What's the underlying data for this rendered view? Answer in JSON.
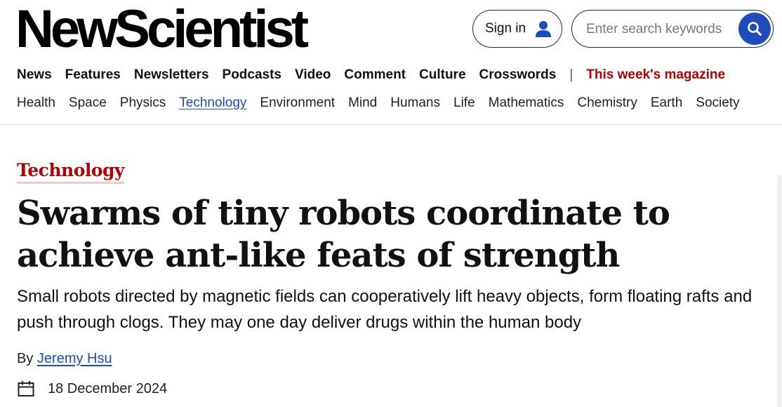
{
  "brand": {
    "logo_text": "NewScientist"
  },
  "account": {
    "signin_label": "Sign in",
    "icon": "user-icon"
  },
  "search": {
    "placeholder": "Enter search keywords",
    "icon": "search-icon",
    "button_color": "#1f4bbc"
  },
  "main_nav": {
    "items": [
      "News",
      "Features",
      "Newsletters",
      "Podcasts",
      "Video",
      "Comment",
      "Culture",
      "Crosswords"
    ],
    "separator": "|",
    "magazine_label": "This week's magazine",
    "magazine_color": "#b30000"
  },
  "sub_nav": {
    "items": [
      "Health",
      "Space",
      "Physics",
      "Technology",
      "Environment",
      "Mind",
      "Humans",
      "Life",
      "Mathematics",
      "Chemistry",
      "Earth",
      "Society"
    ],
    "active": "Technology"
  },
  "article": {
    "category": "Technology",
    "headline": "Swarms of tiny robots coordinate to achieve ant-like feats of strength",
    "standfirst": "Small robots directed by magnetic fields can cooperatively lift heavy objects, form floating rafts and push through clogs. They may one day deliver drugs within the human body",
    "byline_prefix": "By",
    "author": "Jeremy Hsu",
    "date": "18 December 2024",
    "date_icon": "calendar-icon"
  }
}
